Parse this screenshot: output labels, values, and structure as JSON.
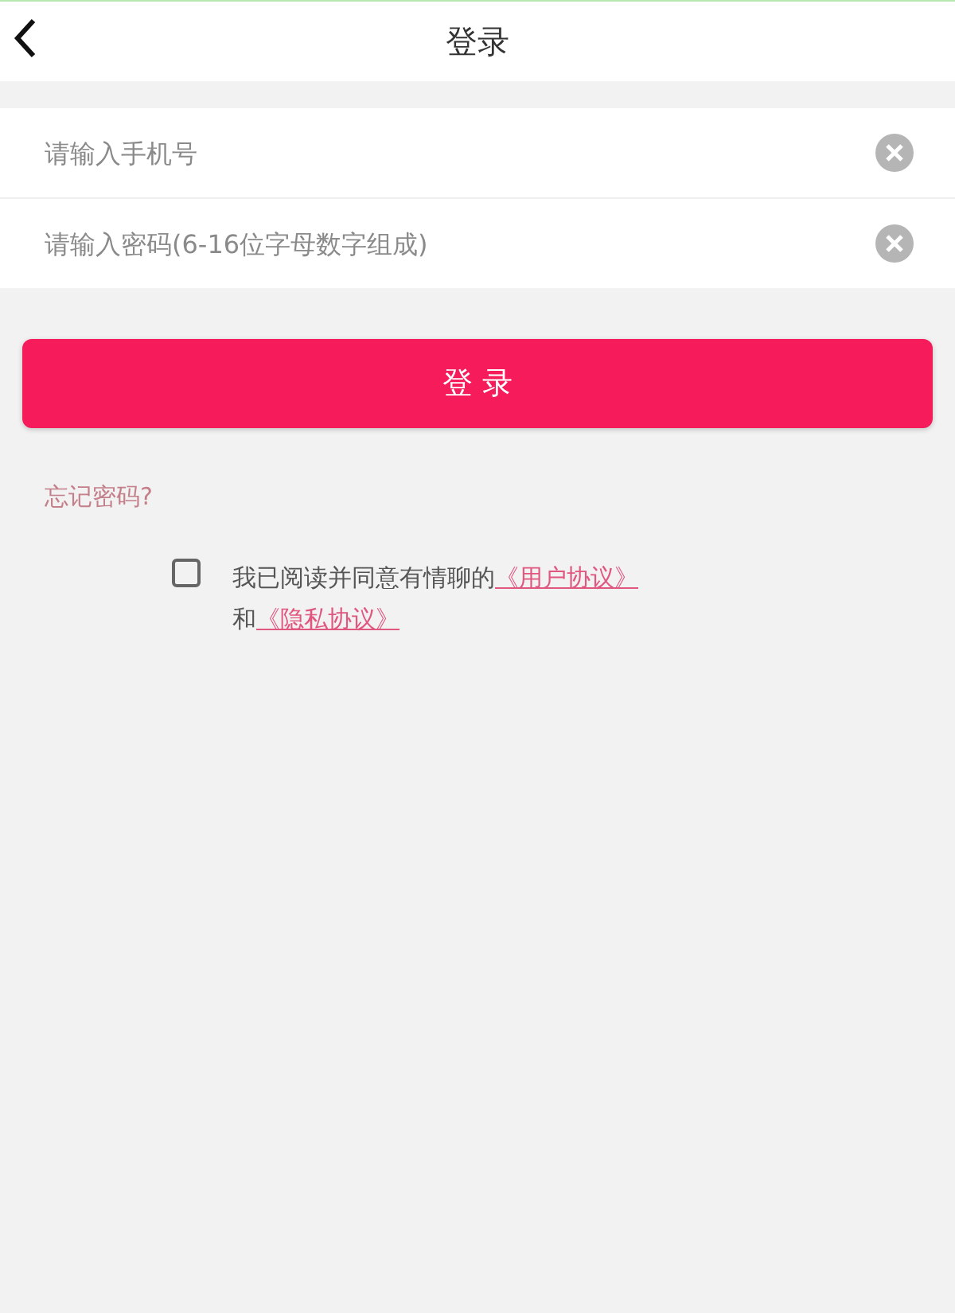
{
  "header": {
    "title": "登录"
  },
  "fields": [
    {
      "placeholder": "请输入手机号"
    },
    {
      "placeholder": "请输入密码(6-16位字母数字组成)"
    }
  ],
  "login_button": "登 录",
  "forgot_link": "忘记密码?",
  "agreement": {
    "checked": false,
    "text": "我已阅读并同意有情聊的",
    "link_1": "《用户协议》",
    "joiner": "和",
    "link_2": "《隐私协议》"
  }
}
